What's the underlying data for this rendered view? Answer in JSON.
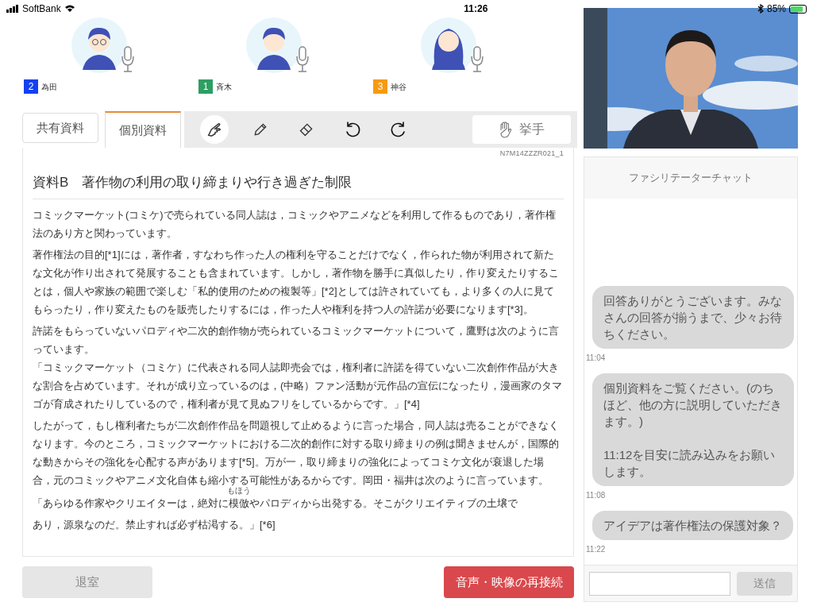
{
  "status_bar": {
    "carrier": "SoftBank",
    "time": "11:26",
    "battery": "85%"
  },
  "participants": [
    {
      "number": "2",
      "name": "為田",
      "color": "#1340f0",
      "kind": "glasses"
    },
    {
      "number": "1",
      "name": "斉木",
      "color": "#2e9e62",
      "kind": "boy"
    },
    {
      "number": "3",
      "name": "神谷",
      "color": "#f79a0e",
      "kind": "girl"
    }
  ],
  "tabs": [
    {
      "label": "共有資料",
      "selected": false
    },
    {
      "label": "個別資料",
      "selected": true
    }
  ],
  "tools": [
    {
      "kind": "pointer",
      "selected": true
    },
    {
      "kind": "pencil",
      "selected": false
    },
    {
      "kind": "eraser",
      "selected": false
    },
    {
      "kind": "undo",
      "selected": false
    },
    {
      "kind": "redo",
      "selected": false
    }
  ],
  "raise_hand": "挙手",
  "document": {
    "id": "N7M14ZZZR021_1",
    "title": "資料B　著作物の利用の取り締まりや行き過ぎた制限",
    "paragraphs": [
      {
        "lines": [
          "コミックマーケット(コミケ)で売られている同人誌は，コミックやアニメなどを利用して作るものであり，著作権法のあり方と関わっています。"
        ]
      },
      {
        "lines": [
          "著作権法の目的[*1]には，著作者，すなわち作った人の権利を守ることだけでなく，作られた物が利用されて新たな文化が作り出されて発展することも含まれています。しかし，著作物を勝手に真似したり，作り変えたりすることは，個人や家族の範囲で楽しむ「私的使用のための複製等」[*2]としては許されていても，より多くの人に見てもらったり，作り変えたものを販売したりするには，作った人や権利を持つ人の許諾が必要になります[*3]。"
        ]
      },
      {
        "lines": [
          "許諾をもらっていないパロディや二次的創作物が売られているコミックマーケットについて，鷹野は次のように言っています。",
          "「コミックマーケット（コミケ）に代表される同人誌即売会では，権利者に許諾を得ていない二次創作作品が大きな割合を占めています。それが成り立っているのは，(中略）ファン活動が元作品の宣伝になったり，漫画家のタマゴが育成されたりしているので，権利者が見て見ぬフリをしているからです。」[*4]"
        ]
      },
      {
        "lines": [
          "したがって，もし権利者たちが二次創作作品を問題視して止めるように言った場合，同人誌は売ることができなくなります。今のところ，コミックマーケットにおける二次的創作に対する取り締まりの例は聞きませんが，国際的な動きからその強化を心配する声があります[*5]。万が一，取り締まりの強化によってコミケ文化が衰退した場合，元のコミックやアニメ文化自体も縮小する可能性があるからです。岡田・福井は次のように言っています。"
        ]
      }
    ],
    "quote": {
      "before": "「あらゆる作家やクリエイターは，絶対に",
      "ruby_base": "模倣",
      "ruby_text": "もほう",
      "after": "やパロディから出発する。そこがクリエイティブの土壌で",
      "next_line": "あり，源泉なのだ。禁止すれば必ず枯渇する。」[*6]"
    }
  },
  "buttons": {
    "leave": "退室",
    "reconnect": "音声・映像の再接続"
  },
  "chat": {
    "title": "ファシリテーターチャット",
    "messages": [
      {
        "paragraphs": [
          "回答ありがとうございます。みなさんの回答が揃うまで、少々お待ちください。"
        ],
        "time": "11:04"
      },
      {
        "paragraphs": [
          "個別資料をご覧ください。(のちほど、他の方に説明していただきます。)",
          "11:12を目安に読み込みをお願いします。"
        ],
        "time": "11:08"
      },
      {
        "paragraphs": [
          "アイデアは著作権法の保護対象？"
        ],
        "time": "11:22"
      }
    ],
    "send": "送信"
  }
}
